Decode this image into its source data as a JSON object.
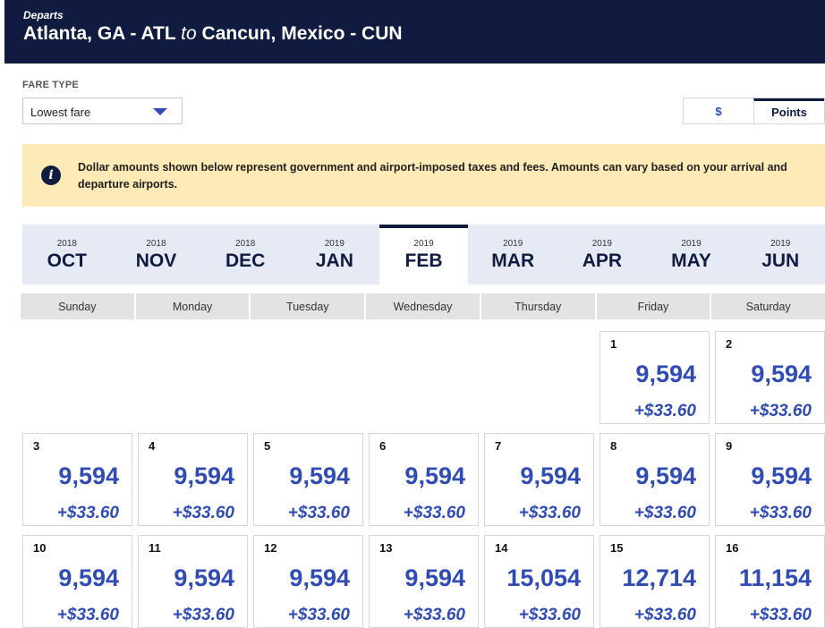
{
  "header": {
    "sub": "Departs",
    "origin": "Atlanta, GA - ATL",
    "to": "to",
    "destination": "Cancun, Mexico - CUN"
  },
  "fare_type": {
    "label": "FARE TYPE",
    "selected": "Lowest fare"
  },
  "currency_toggle": {
    "options": [
      "$",
      "Points"
    ],
    "active": "Points"
  },
  "notice": {
    "icon": "info-icon",
    "text": "Dollar amounts shown below represent government and airport-imposed taxes and fees. Amounts can vary based on your arrival and departure airports."
  },
  "months": [
    {
      "year": "2018",
      "month": "OCT"
    },
    {
      "year": "2018",
      "month": "NOV"
    },
    {
      "year": "2018",
      "month": "DEC"
    },
    {
      "year": "2019",
      "month": "JAN"
    },
    {
      "year": "2019",
      "month": "FEB"
    },
    {
      "year": "2019",
      "month": "MAR"
    },
    {
      "year": "2019",
      "month": "APR"
    },
    {
      "year": "2019",
      "month": "MAY"
    },
    {
      "year": "2019",
      "month": "JUN"
    }
  ],
  "active_month": "FEB",
  "weekdays": [
    "Sunday",
    "Monday",
    "Tuesday",
    "Wednesday",
    "Thursday",
    "Friday",
    "Saturday"
  ],
  "days": [
    {
      "day": "1",
      "points": "9,594",
      "fee": "+$33.60"
    },
    {
      "day": "2",
      "points": "9,594",
      "fee": "+$33.60"
    },
    {
      "day": "3",
      "points": "9,594",
      "fee": "+$33.60"
    },
    {
      "day": "4",
      "points": "9,594",
      "fee": "+$33.60"
    },
    {
      "day": "5",
      "points": "9,594",
      "fee": "+$33.60"
    },
    {
      "day": "6",
      "points": "9,594",
      "fee": "+$33.60"
    },
    {
      "day": "7",
      "points": "9,594",
      "fee": "+$33.60"
    },
    {
      "day": "8",
      "points": "9,594",
      "fee": "+$33.60"
    },
    {
      "day": "9",
      "points": "9,594",
      "fee": "+$33.60"
    },
    {
      "day": "10",
      "points": "9,594",
      "fee": "+$33.60"
    },
    {
      "day": "11",
      "points": "9,594",
      "fee": "+$33.60"
    },
    {
      "day": "12",
      "points": "9,594",
      "fee": "+$33.60"
    },
    {
      "day": "13",
      "points": "9,594",
      "fee": "+$33.60"
    },
    {
      "day": "14",
      "points": "15,054",
      "fee": "+$33.60"
    },
    {
      "day": "15",
      "points": "12,714",
      "fee": "+$33.60"
    },
    {
      "day": "16",
      "points": "11,154",
      "fee": "+$33.60"
    }
  ],
  "colors": {
    "navy": "#111b40",
    "accent_blue": "#304cb2",
    "notice_bg": "#fdeab7",
    "month_bar_bg": "#e6eaf5"
  }
}
